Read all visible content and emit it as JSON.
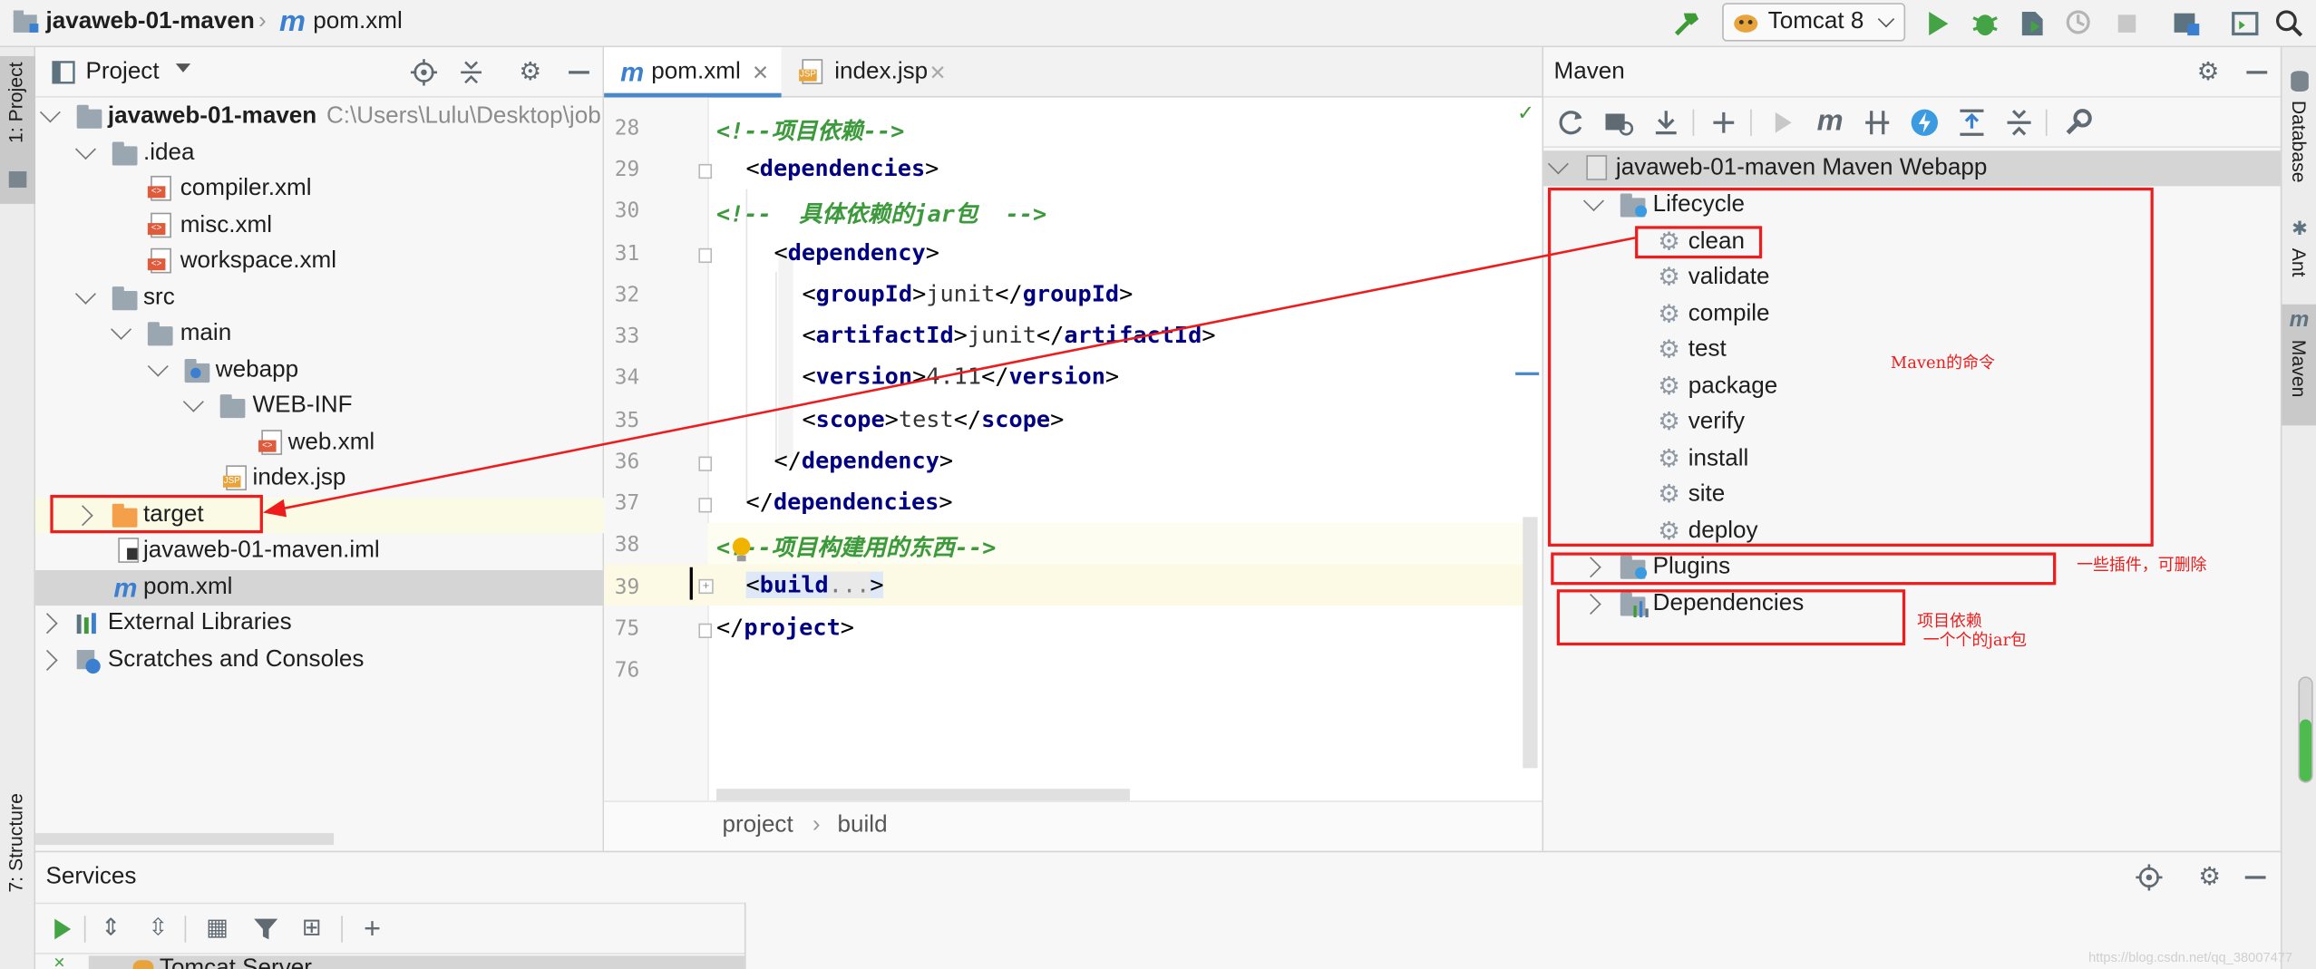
{
  "titlebar": {
    "project_name": "javaweb-01-maven",
    "file_name": "pom.xml",
    "run_config": "Tomcat 8"
  },
  "left_stripe": {
    "project_tab": "1: Project",
    "structure_tab": "7: Structure"
  },
  "right_stripe": {
    "database_tab": "Database",
    "ant_tab": "Ant",
    "maven_tab": "Maven"
  },
  "project_panel": {
    "title": "Project",
    "tree": {
      "root": "javaweb-01-maven",
      "root_path": "C:\\Users\\Lulu\\Desktop\\job",
      "idea": ".idea",
      "compiler": "compiler.xml",
      "misc": "misc.xml",
      "workspace": "workspace.xml",
      "src": "src",
      "main": "main",
      "webapp": "webapp",
      "webinf": "WEB-INF",
      "webxml": "web.xml",
      "indexjsp": "index.jsp",
      "target": "target",
      "iml": "javaweb-01-maven.iml",
      "pom": "pom.xml",
      "ext_libs": "External Libraries",
      "scratches": "Scratches and Consoles"
    }
  },
  "editor": {
    "tabs": [
      {
        "label": "pom.xml",
        "active": true
      },
      {
        "label": "index.jsp",
        "active": false
      }
    ],
    "line_numbers": [
      "28",
      "29",
      "30",
      "31",
      "32",
      "33",
      "34",
      "35",
      "36",
      "37",
      "38",
      "39",
      "75",
      "76"
    ],
    "code": {
      "l28": "<!--项目依赖-->",
      "l29_tag": "dependencies",
      "l30": "<!--  具体依赖的jar包  -->",
      "l31_tag": "dependency",
      "l32_tag": "groupId",
      "l32_val": "junit",
      "l33_tag": "artifactId",
      "l33_val": "junit",
      "l34_tag": "version",
      "l34_val": "4.11",
      "l35_tag": "scope",
      "l35_val": "test",
      "l36_tag": "dependency",
      "l37_tag": "dependencies",
      "l38": "<!--项目构建用的东西-->",
      "l39_tag": "build",
      "l39_fold": "...",
      "l75_tag": "project"
    },
    "breadcrumbs": [
      "project",
      "build"
    ]
  },
  "maven_panel": {
    "title": "Maven",
    "project": "javaweb-01-maven Maven Webapp",
    "lifecycle_label": "Lifecycle",
    "lifecycle": [
      "clean",
      "validate",
      "compile",
      "test",
      "package",
      "verify",
      "install",
      "site",
      "deploy"
    ],
    "plugins_label": "Plugins",
    "dependencies_label": "Dependencies"
  },
  "annotations": {
    "maven_commands": "Maven的命令",
    "plugins_note": "一些插件，可删除",
    "deps_note_1": "项目依赖",
    "deps_note_2": "一个个的jar包",
    "watermark": "https://blog.csdn.net/qq_38007477"
  },
  "services": {
    "title": "Services",
    "tree_item": "Tomcat Server"
  },
  "colors": {
    "annotation_red": "#ee1c1c",
    "xml_tag": "#000080",
    "comment": "#3c9a3c",
    "selection": "#dfe8f6"
  }
}
